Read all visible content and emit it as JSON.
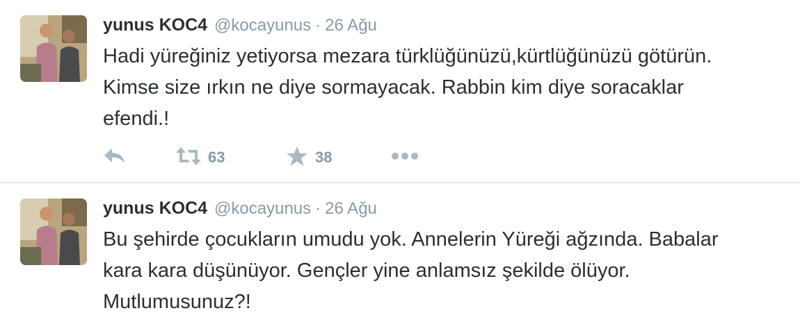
{
  "tweets": [
    {
      "fullname": "yunus KOC4",
      "username": "@kocayunus",
      "separator": "·",
      "time": "26 Ağu",
      "lines": [
        "Hadi yüreğiniz yetiyorsa mezara türklüğünüzü,kürtlüğünüzü götürün.",
        "Kimse size ırkın ne diye sormayacak. Rabbin kim diye soracaklar",
        "efendi.!"
      ],
      "retweets": "63",
      "favorites": "38",
      "icons": [
        "reply-icon",
        "retweet-icon",
        "favorite-icon",
        "more-icon"
      ]
    },
    {
      "fullname": "yunus KOC4",
      "username": "@kocayunus",
      "separator": "·",
      "time": "26 Ağu",
      "lines": [
        "Bu şehirde çocukların umudu yok. Annelerin Yüreği ağzında. Babalar",
        "kara kara düşünüyor. Gençler yine anlamsız şekilde ölüyor.",
        "Mutlumusunuz?!"
      ]
    }
  ],
  "colors": {
    "text": "#292f33",
    "muted": "#8899a6",
    "icon": "#aab8c2",
    "divider": "#e1e8ed"
  }
}
